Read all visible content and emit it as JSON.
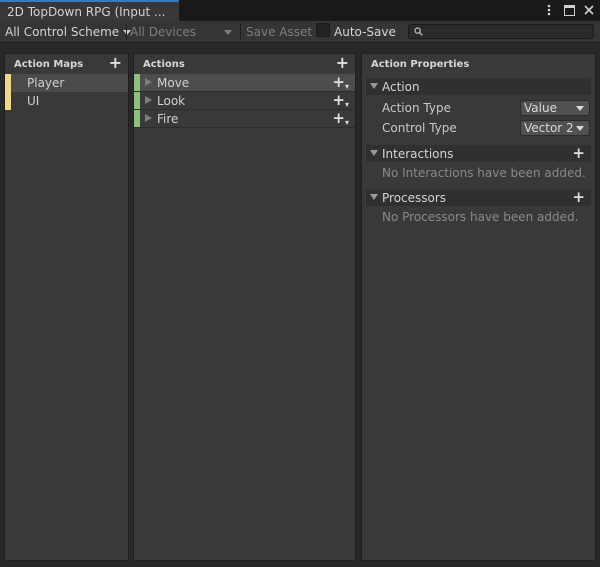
{
  "window": {
    "tab_title": "2D TopDown RPG (Input ..."
  },
  "toolbar": {
    "control_scheme": "All Control Scheme",
    "devices": "All Devices",
    "save_asset": "Save Asset",
    "auto_save": "Auto-Save",
    "search_value": ""
  },
  "action_maps": {
    "header": "Action Maps",
    "items": [
      {
        "label": "Player"
      },
      {
        "label": "UI"
      }
    ]
  },
  "actions": {
    "header": "Actions",
    "items": [
      {
        "label": "Move"
      },
      {
        "label": "Look"
      },
      {
        "label": "Fire"
      }
    ]
  },
  "properties": {
    "header": "Action Properties",
    "action_section": "Action",
    "action_type_label": "Action Type",
    "action_type_value": "Value",
    "control_type_label": "Control Type",
    "control_type_value": "Vector 2",
    "interactions_section": "Interactions",
    "interactions_empty": "No Interactions have been added.",
    "processors_section": "Processors",
    "processors_empty": "No Processors have been added."
  },
  "colors": {
    "accent_tab": "#3a79bb",
    "map_stripe": "#f0d889",
    "action_stripe": "#8ec07c"
  }
}
